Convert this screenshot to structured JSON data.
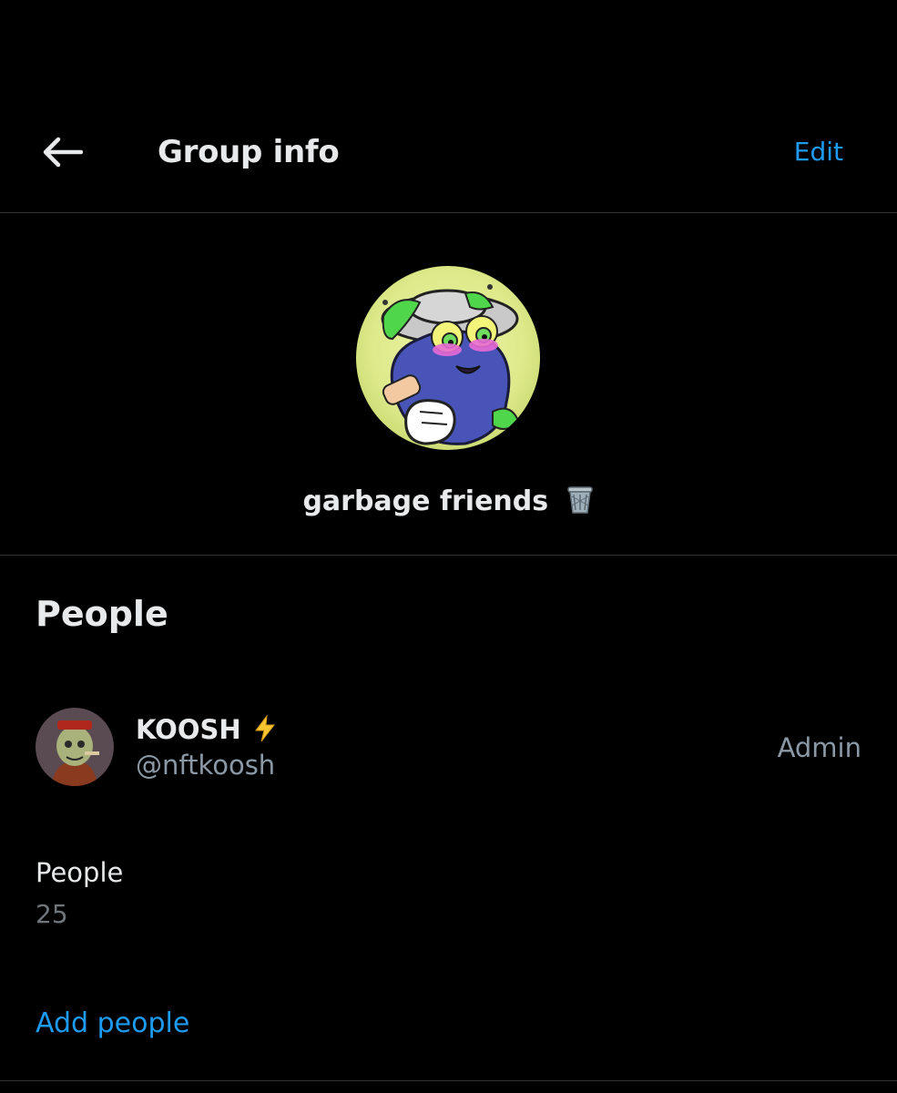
{
  "header": {
    "title": "Group info",
    "edit_label": "Edit",
    "back_icon": "arrow-left-icon"
  },
  "group": {
    "name": "garbage friends",
    "name_emoji": "wastebasket-icon",
    "avatar": "cartoon-blob-character-avatar"
  },
  "people_section": {
    "heading": "People",
    "members": [
      {
        "name": "KOOSH",
        "name_emoji": "lightning-icon",
        "handle": "@nftkoosh",
        "role": "Admin",
        "avatar": "ape-character-avatar"
      }
    ],
    "count_label": "People",
    "count_value": "25",
    "add_people_label": "Add people"
  },
  "colors": {
    "background": "#000000",
    "accent": "#1d9bf0",
    "primary_text": "#e7e9ea",
    "secondary_text": "#8b98a5",
    "divider": "#2f3336"
  }
}
